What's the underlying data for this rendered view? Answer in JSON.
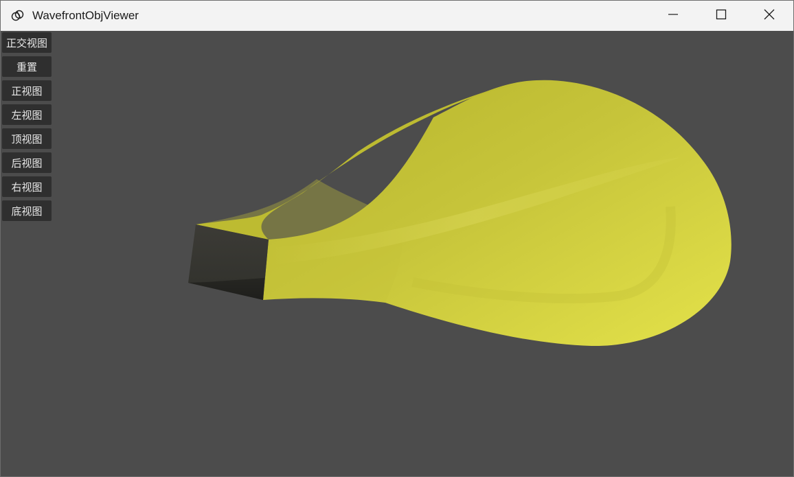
{
  "window": {
    "title": "WavefrontObjViewer",
    "app_icon": "viewer-logo-icon",
    "controls": {
      "minimize_icon": "minimize-icon",
      "maximize_icon": "maximize-icon",
      "close_icon": "close-icon"
    }
  },
  "toolbar": {
    "buttons": [
      {
        "id": "orthographic",
        "label": "正交视图"
      },
      {
        "id": "reset",
        "label": "重置"
      },
      {
        "id": "front",
        "label": "正视图"
      },
      {
        "id": "left",
        "label": "左视图"
      },
      {
        "id": "top",
        "label": "顶视图"
      },
      {
        "id": "back",
        "label": "后视图"
      },
      {
        "id": "right",
        "label": "右视图"
      },
      {
        "id": "bottom",
        "label": "底视图"
      }
    ]
  },
  "scene": {
    "background_color": "#4c4c4c",
    "model_color": "#d4d040",
    "model_shadow_color": "#b8b52f",
    "end_cap_color": "#3a3a35"
  }
}
